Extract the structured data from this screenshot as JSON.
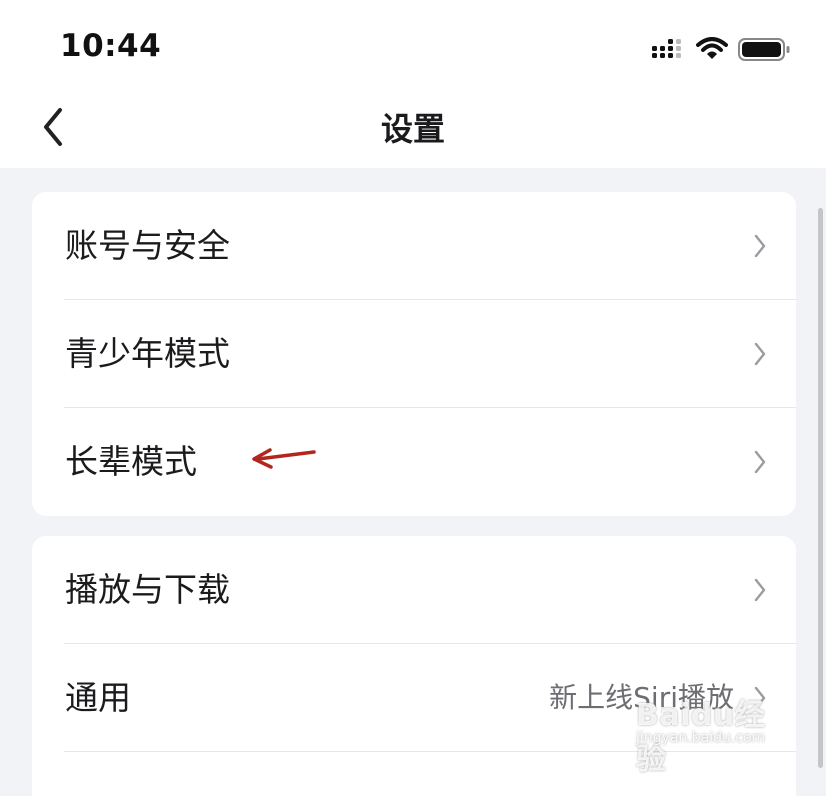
{
  "status_bar": {
    "time": "10:44",
    "icons": [
      "cellular-signal-icon",
      "wifi-icon",
      "battery-icon"
    ]
  },
  "nav": {
    "title": "设置",
    "back_icon": "chevron-left-icon"
  },
  "groups": [
    {
      "items": [
        {
          "label": "账号与安全",
          "value": ""
        },
        {
          "label": "青少年模式",
          "value": ""
        },
        {
          "label": "长辈模式",
          "value": ""
        }
      ]
    },
    {
      "items": [
        {
          "label": "播放与下载",
          "value": ""
        },
        {
          "label": "通用",
          "value": "新上线Siri播放"
        }
      ]
    }
  ],
  "annotation": {
    "icon": "red-arrow-icon",
    "color": "#b3261e"
  },
  "watermark": {
    "brand": "Baidu经验",
    "url": "jingyan.baidu.com"
  },
  "colors": {
    "background": "#f2f3f7",
    "card": "#ffffff",
    "text": "#1b1b1d",
    "secondary_text": "#6d6e73",
    "chevron": "#9a9ba0"
  }
}
